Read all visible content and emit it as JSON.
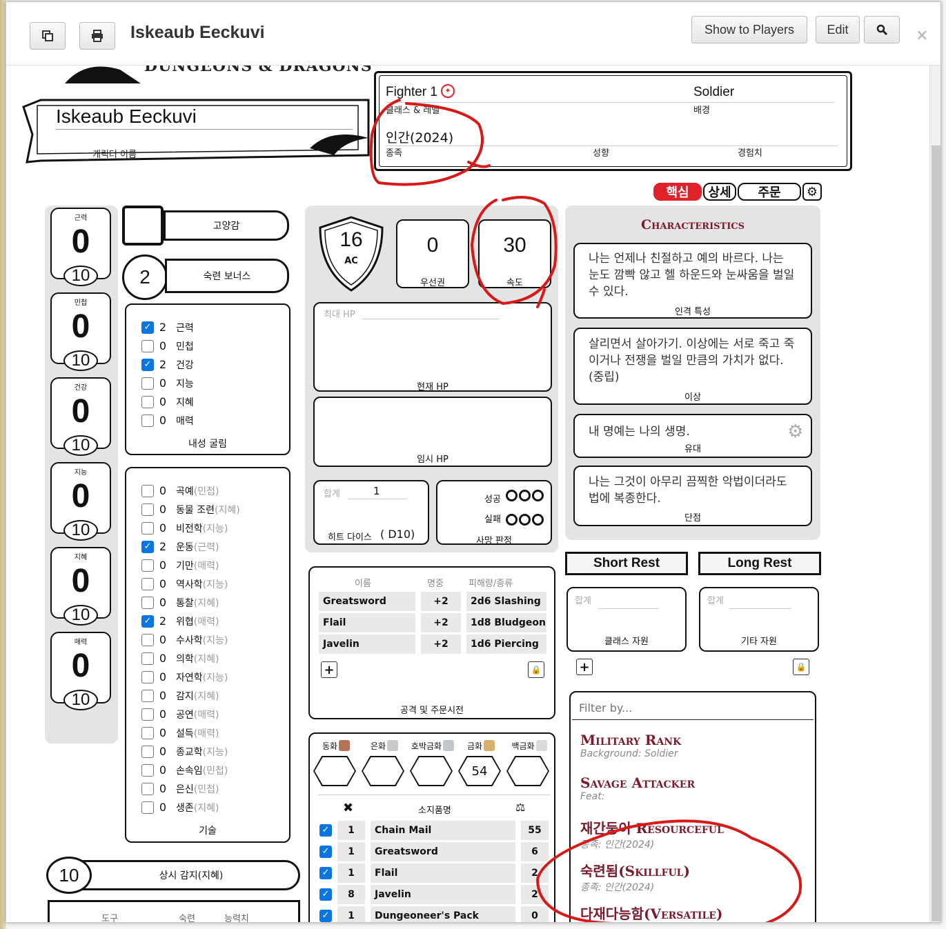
{
  "window": {
    "title": "Iskeaub Eeckuvi",
    "show_players": "Show to Players",
    "edit": "Edit",
    "close": "×"
  },
  "header": {
    "logo_text": "DUNGEONS & DRAGONS",
    "char_name": "Iskeaub Eeckuvi",
    "char_name_label": "캐릭터 이름",
    "class_level": "Fighter 1",
    "class_label": "클래스 & 레벨",
    "background": "Soldier",
    "background_label": "배경",
    "race": "인간(2024)",
    "race_label": "종족",
    "alignment_label": "성향",
    "xp_label": "경험치"
  },
  "tabs": {
    "core": "핵심",
    "detail": "상세",
    "spells": "주문"
  },
  "abilities": [
    {
      "name": "근력",
      "mod": "0",
      "score": "10"
    },
    {
      "name": "민첩",
      "mod": "0",
      "score": "10"
    },
    {
      "name": "건강",
      "mod": "0",
      "score": "10"
    },
    {
      "name": "지능",
      "mod": "0",
      "score": "10"
    },
    {
      "name": "지혜",
      "mod": "0",
      "score": "10"
    },
    {
      "name": "매력",
      "mod": "0",
      "score": "10"
    }
  ],
  "inspiration_label": "고양감",
  "proficiency": {
    "value": "2",
    "label": "숙련 보너스"
  },
  "saves": {
    "label": "내성 굴림",
    "items": [
      {
        "checked": true,
        "value": "2",
        "name": "근력"
      },
      {
        "checked": false,
        "value": "0",
        "name": "민첩"
      },
      {
        "checked": true,
        "value": "2",
        "name": "건강"
      },
      {
        "checked": false,
        "value": "0",
        "name": "지능"
      },
      {
        "checked": false,
        "value": "0",
        "name": "지혜"
      },
      {
        "checked": false,
        "value": "0",
        "name": "매력"
      }
    ]
  },
  "skills": {
    "label": "기술",
    "items": [
      {
        "checked": false,
        "value": "0",
        "name": "곡예",
        "ability": "(민첩)"
      },
      {
        "checked": false,
        "value": "0",
        "name": "동물 조련",
        "ability": "(지혜)"
      },
      {
        "checked": false,
        "value": "0",
        "name": "비전학",
        "ability": "(지능)"
      },
      {
        "checked": true,
        "value": "2",
        "name": "운동",
        "ability": "(근력)"
      },
      {
        "checked": false,
        "value": "0",
        "name": "기만",
        "ability": "(매력)"
      },
      {
        "checked": false,
        "value": "0",
        "name": "역사학",
        "ability": "(지능)"
      },
      {
        "checked": false,
        "value": "0",
        "name": "통찰 ",
        "ability": "(지혜)"
      },
      {
        "checked": true,
        "value": "2",
        "name": "위협",
        "ability": "(매력)"
      },
      {
        "checked": false,
        "value": "0",
        "name": "수사학",
        "ability": "(지능)"
      },
      {
        "checked": false,
        "value": "0",
        "name": "의학",
        "ability": "(지혜)"
      },
      {
        "checked": false,
        "value": "0",
        "name": "자연학",
        "ability": "(지능)"
      },
      {
        "checked": false,
        "value": "0",
        "name": "감지",
        "ability": "(지혜)"
      },
      {
        "checked": false,
        "value": "0",
        "name": "공연",
        "ability": "(매력)"
      },
      {
        "checked": false,
        "value": "0",
        "name": "설득",
        "ability": "(매력)"
      },
      {
        "checked": false,
        "value": "0",
        "name": "종교학",
        "ability": "(지능)"
      },
      {
        "checked": false,
        "value": "0",
        "name": "손속임",
        "ability": "(민첩)"
      },
      {
        "checked": false,
        "value": "0",
        "name": "은신",
        "ability": "(민첩)"
      },
      {
        "checked": false,
        "value": "0",
        "name": "생존",
        "ability": "(지혜)"
      }
    ]
  },
  "passive": {
    "value": "10",
    "label": "상시 감지(지혜)"
  },
  "tools": {
    "col1": "도구",
    "col2": "숙련",
    "col3": "능력치"
  },
  "combat": {
    "ac": "16",
    "ac_label": "AC",
    "initiative": "0",
    "initiative_label": "우선권",
    "speed": "30",
    "speed_label": "속도",
    "max_hp_label": "최대 HP",
    "current_hp_label": "현재 HP",
    "temp_hp_label": "임시 HP",
    "hit_dice_total_label": "합계",
    "hit_dice_total": "1",
    "hit_dice_label": "히트 다이스",
    "hit_dice_value": "D10",
    "death_success": "성공",
    "death_fail": "실패",
    "death_label": "사망 판정"
  },
  "attacks": {
    "col_name": "이름",
    "col_hit": "명중",
    "col_dmg": "피해량/종류",
    "rows": [
      {
        "name": "Greatsword",
        "hit": "+2",
        "dmg": "2d6 Slashing"
      },
      {
        "name": "Flail",
        "hit": "+2",
        "dmg": "1d8 Bludgeoning"
      },
      {
        "name": "Javelin",
        "hit": "+2",
        "dmg": "1d6 Piercing"
      }
    ],
    "label": "공격 및 주문시전"
  },
  "coins": [
    {
      "name": "동화",
      "value": ""
    },
    {
      "name": "은화",
      "value": ""
    },
    {
      "name": "호박금화",
      "value": ""
    },
    {
      "name": "금화",
      "value": "54"
    },
    {
      "name": "백금화",
      "value": ""
    }
  ],
  "inventory": {
    "col_item": "소지품명",
    "rows": [
      {
        "checked": true,
        "qty": "1",
        "name": "Chain Mail",
        "weight": "55"
      },
      {
        "checked": true,
        "qty": "1",
        "name": "Greatsword",
        "weight": "6"
      },
      {
        "checked": true,
        "qty": "1",
        "name": "Flail",
        "weight": "2"
      },
      {
        "checked": true,
        "qty": "8",
        "name": "Javelin",
        "weight": "2"
      },
      {
        "checked": true,
        "qty": "1",
        "name": "Dungeoneer's Pack",
        "weight": "0"
      }
    ]
  },
  "characteristics": {
    "title": "Characteristics",
    "traits": "나는 언제나 친절하고 예의 바르다. 나는 눈도 깜빡 않고 헬 하운드와 눈싸움을 벌일 수 있다.",
    "traits_label": "인격 특성",
    "ideals": "살리면서 살아가기. 이상에는 서로 죽고 죽이거나 전쟁을 벌일 만큼의 가치가 없다. (중립)",
    "ideals_label": "이상",
    "bonds": "내 명예는 나의 생명.",
    "bonds_label": "유대",
    "flaws": "나는 그것이 아무리 끔찍한 악법이더라도 법에 복종한다.",
    "flaws_label": "단점"
  },
  "rest": {
    "short": "Short Rest",
    "long": "Long Rest"
  },
  "resources": {
    "total_label": "합계",
    "class_label": "클래스 자원",
    "other_label": "기타 자원"
  },
  "features": {
    "filter_placeholder": "Filter by...",
    "items": [
      {
        "name": "Military Rank",
        "source": "Background: Soldier"
      },
      {
        "name": "Savage Attacker",
        "source": "Feat:"
      },
      {
        "name": "재간둥이 Resourceful",
        "source": "종족: 인간(2024)"
      },
      {
        "name": "숙련됨(Skillful)",
        "source": "종족: 인간(2024)"
      },
      {
        "name": "다재다능함(Versatile)",
        "source": ""
      }
    ]
  },
  "colors": {
    "accent_red": "#e0222a",
    "feature_red": "#7a1a2a",
    "check_blue": "#0b75e0",
    "annotation_red": "#d91818"
  }
}
